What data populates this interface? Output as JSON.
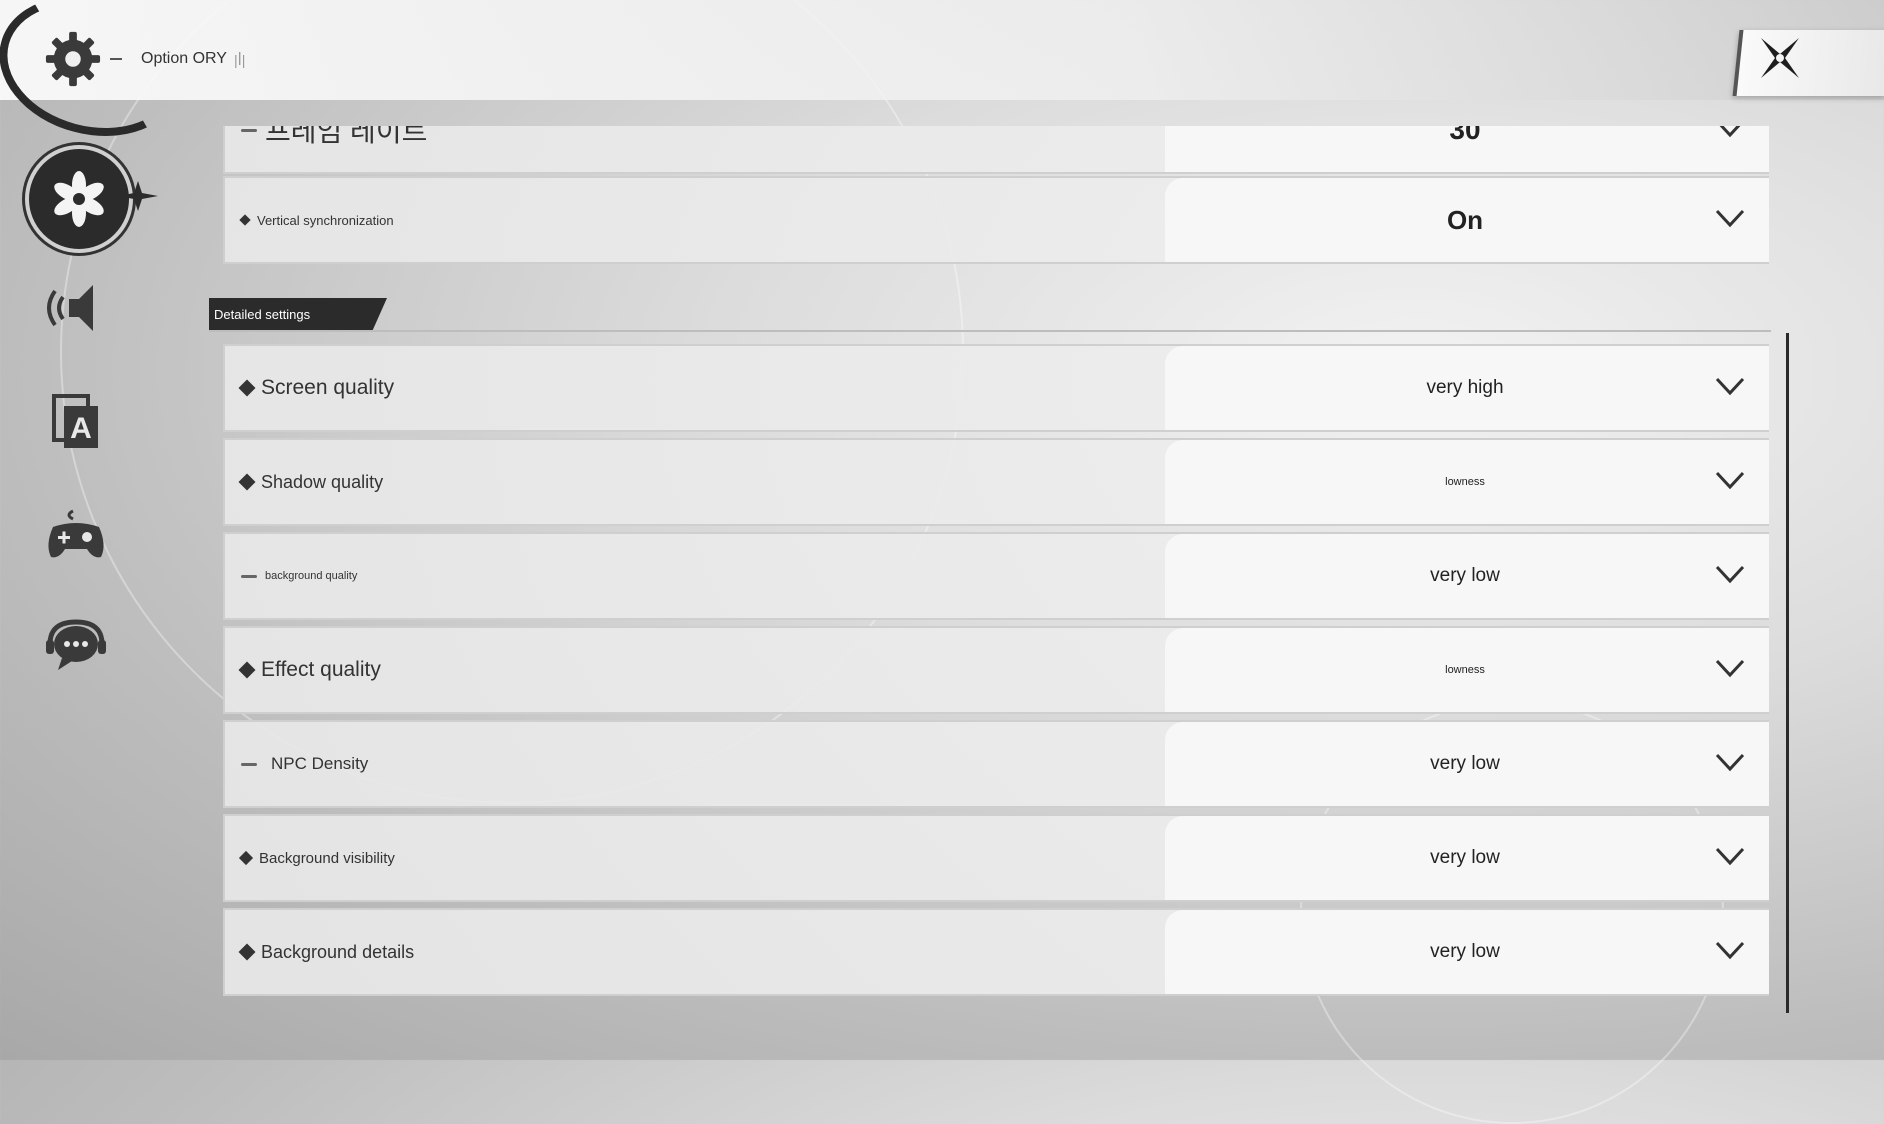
{
  "window": {
    "title": "Option ORY",
    "title_mark": "|ꟾ|"
  },
  "sidebar": {
    "items": [
      {
        "name": "graphics",
        "icon": "flower-gear-icon",
        "active": true
      },
      {
        "name": "sound",
        "icon": "speaker-icon",
        "active": false
      },
      {
        "name": "language",
        "icon": "language-a-icon",
        "active": false
      },
      {
        "name": "controls",
        "icon": "gamepad-icon",
        "active": false
      },
      {
        "name": "support",
        "icon": "chat-headset-icon",
        "active": false
      }
    ]
  },
  "top_partial_row": {
    "label": "프레임 레이트",
    "value": "30"
  },
  "vsync": {
    "label": "Vertical synchronization",
    "value": "On"
  },
  "section": {
    "title": "Detailed settings"
  },
  "settings": [
    {
      "label": "Screen quality",
      "value": "very high"
    },
    {
      "label": "Shadow quality",
      "value": "lowness"
    },
    {
      "label": "background quality",
      "value": "very low"
    },
    {
      "label": "Effect quality",
      "value": "lowness"
    },
    {
      "label": "NPC Density",
      "value": "very low"
    },
    {
      "label": "Background visibility",
      "value": "very low"
    },
    {
      "label": "Background details",
      "value": "very low"
    }
  ],
  "colors": {
    "accent": "#2b2b2b",
    "row_bg": "#e8e8e8",
    "value_bg": "#f7f7f7"
  }
}
